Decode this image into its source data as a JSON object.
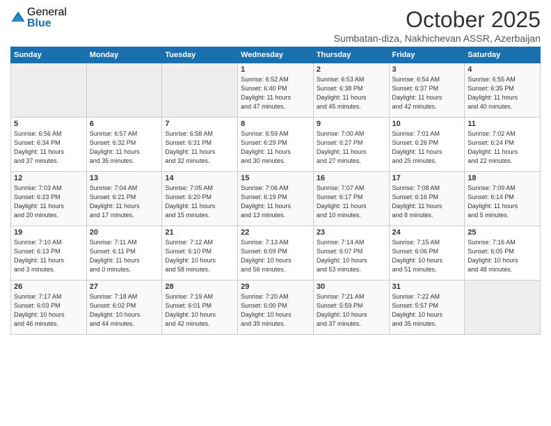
{
  "logo": {
    "general": "General",
    "blue": "Blue"
  },
  "header": {
    "month": "October 2025",
    "location": "Sumbatan-diza, Nakhichevan ASSR, Azerbaijan"
  },
  "weekdays": [
    "Sunday",
    "Monday",
    "Tuesday",
    "Wednesday",
    "Thursday",
    "Friday",
    "Saturday"
  ],
  "weeks": [
    [
      {
        "day": "",
        "info": ""
      },
      {
        "day": "",
        "info": ""
      },
      {
        "day": "",
        "info": ""
      },
      {
        "day": "1",
        "info": "Sunrise: 6:52 AM\nSunset: 6:40 PM\nDaylight: 11 hours\nand 47 minutes."
      },
      {
        "day": "2",
        "info": "Sunrise: 6:53 AM\nSunset: 6:38 PM\nDaylight: 11 hours\nand 45 minutes."
      },
      {
        "day": "3",
        "info": "Sunrise: 6:54 AM\nSunset: 6:37 PM\nDaylight: 11 hours\nand 42 minutes."
      },
      {
        "day": "4",
        "info": "Sunrise: 6:55 AM\nSunset: 6:35 PM\nDaylight: 11 hours\nand 40 minutes."
      }
    ],
    [
      {
        "day": "5",
        "info": "Sunrise: 6:56 AM\nSunset: 6:34 PM\nDaylight: 11 hours\nand 37 minutes."
      },
      {
        "day": "6",
        "info": "Sunrise: 6:57 AM\nSunset: 6:32 PM\nDaylight: 11 hours\nand 35 minutes."
      },
      {
        "day": "7",
        "info": "Sunrise: 6:58 AM\nSunset: 6:31 PM\nDaylight: 11 hours\nand 32 minutes."
      },
      {
        "day": "8",
        "info": "Sunrise: 6:59 AM\nSunset: 6:29 PM\nDaylight: 11 hours\nand 30 minutes."
      },
      {
        "day": "9",
        "info": "Sunrise: 7:00 AM\nSunset: 6:27 PM\nDaylight: 11 hours\nand 27 minutes."
      },
      {
        "day": "10",
        "info": "Sunrise: 7:01 AM\nSunset: 6:26 PM\nDaylight: 11 hours\nand 25 minutes."
      },
      {
        "day": "11",
        "info": "Sunrise: 7:02 AM\nSunset: 6:24 PM\nDaylight: 11 hours\nand 22 minutes."
      }
    ],
    [
      {
        "day": "12",
        "info": "Sunrise: 7:03 AM\nSunset: 6:23 PM\nDaylight: 11 hours\nand 20 minutes."
      },
      {
        "day": "13",
        "info": "Sunrise: 7:04 AM\nSunset: 6:21 PM\nDaylight: 11 hours\nand 17 minutes."
      },
      {
        "day": "14",
        "info": "Sunrise: 7:05 AM\nSunset: 6:20 PM\nDaylight: 11 hours\nand 15 minutes."
      },
      {
        "day": "15",
        "info": "Sunrise: 7:06 AM\nSunset: 6:19 PM\nDaylight: 11 hours\nand 13 minutes."
      },
      {
        "day": "16",
        "info": "Sunrise: 7:07 AM\nSunset: 6:17 PM\nDaylight: 11 hours\nand 10 minutes."
      },
      {
        "day": "17",
        "info": "Sunrise: 7:08 AM\nSunset: 6:16 PM\nDaylight: 11 hours\nand 8 minutes."
      },
      {
        "day": "18",
        "info": "Sunrise: 7:09 AM\nSunset: 6:14 PM\nDaylight: 11 hours\nand 5 minutes."
      }
    ],
    [
      {
        "day": "19",
        "info": "Sunrise: 7:10 AM\nSunset: 6:13 PM\nDaylight: 11 hours\nand 3 minutes."
      },
      {
        "day": "20",
        "info": "Sunrise: 7:11 AM\nSunset: 6:11 PM\nDaylight: 11 hours\nand 0 minutes."
      },
      {
        "day": "21",
        "info": "Sunrise: 7:12 AM\nSunset: 6:10 PM\nDaylight: 10 hours\nand 58 minutes."
      },
      {
        "day": "22",
        "info": "Sunrise: 7:13 AM\nSunset: 6:09 PM\nDaylight: 10 hours\nand 56 minutes."
      },
      {
        "day": "23",
        "info": "Sunrise: 7:14 AM\nSunset: 6:07 PM\nDaylight: 10 hours\nand 53 minutes."
      },
      {
        "day": "24",
        "info": "Sunrise: 7:15 AM\nSunset: 6:06 PM\nDaylight: 10 hours\nand 51 minutes."
      },
      {
        "day": "25",
        "info": "Sunrise: 7:16 AM\nSunset: 6:05 PM\nDaylight: 10 hours\nand 48 minutes."
      }
    ],
    [
      {
        "day": "26",
        "info": "Sunrise: 7:17 AM\nSunset: 6:03 PM\nDaylight: 10 hours\nand 46 minutes."
      },
      {
        "day": "27",
        "info": "Sunrise: 7:18 AM\nSunset: 6:02 PM\nDaylight: 10 hours\nand 44 minutes."
      },
      {
        "day": "28",
        "info": "Sunrise: 7:19 AM\nSunset: 6:01 PM\nDaylight: 10 hours\nand 42 minutes."
      },
      {
        "day": "29",
        "info": "Sunrise: 7:20 AM\nSunset: 6:00 PM\nDaylight: 10 hours\nand 39 minutes."
      },
      {
        "day": "30",
        "info": "Sunrise: 7:21 AM\nSunset: 5:59 PM\nDaylight: 10 hours\nand 37 minutes."
      },
      {
        "day": "31",
        "info": "Sunrise: 7:22 AM\nSunset: 5:57 PM\nDaylight: 10 hours\nand 35 minutes."
      },
      {
        "day": "",
        "info": ""
      }
    ]
  ]
}
